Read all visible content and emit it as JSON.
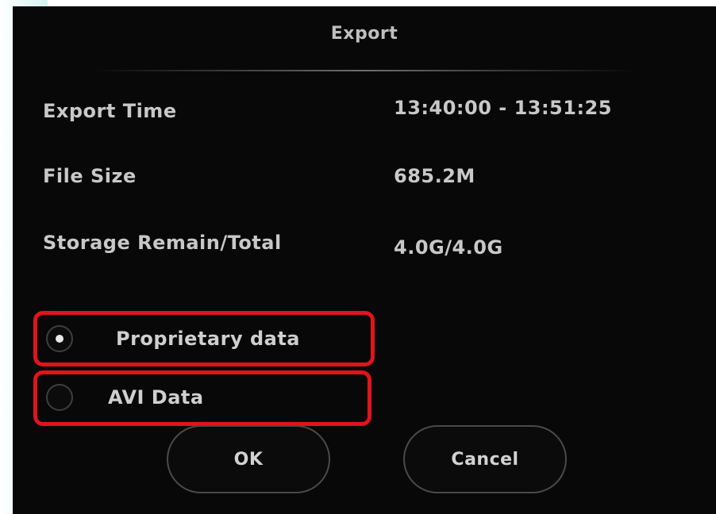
{
  "dialog": {
    "title": "Export",
    "info": {
      "export_time_label": "Export Time",
      "export_time_value": "13:40:00 - 13:51:25",
      "file_size_label": "File Size",
      "file_size_value": "685.2M",
      "storage_label": "Storage Remain/Total",
      "storage_value": "4.0G/4.0G"
    },
    "format_options": [
      {
        "label": "Proprietary data",
        "selected": true
      },
      {
        "label": "AVI Data",
        "selected": false
      }
    ],
    "buttons": {
      "ok_label": "OK",
      "cancel_label": "Cancel"
    }
  },
  "colors": {
    "dialog_background": "#080808",
    "text": "#c8c8c8",
    "highlight_frame": "#e0141b"
  }
}
